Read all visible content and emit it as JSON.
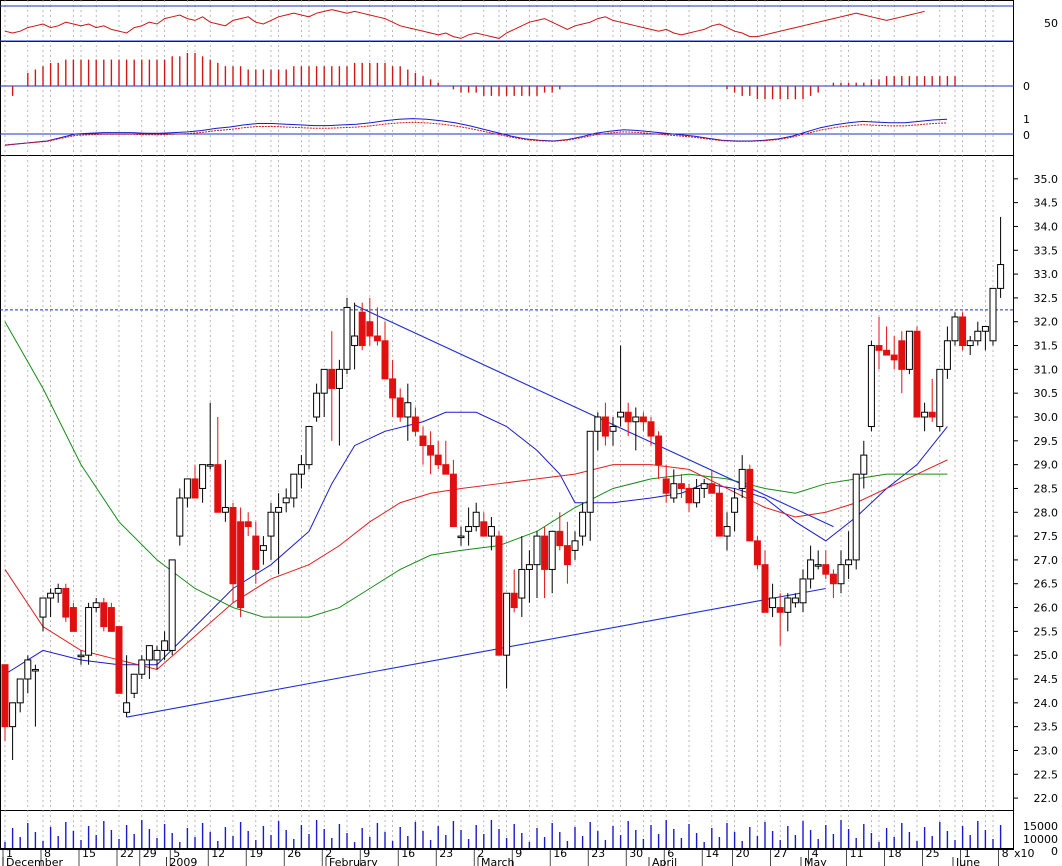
{
  "chart_data": {
    "type": "candlestick",
    "price_axis": {
      "min": 21.75,
      "max": 35.5,
      "ticks": [
        "22.0",
        "22.5",
        "23.0",
        "23.5",
        "24.0",
        "24.5",
        "25.0",
        "25.5",
        "26.0",
        "26.5",
        "27.0",
        "27.5",
        "28.0",
        "28.5",
        "29.0",
        "29.5",
        "30.0",
        "30.5",
        "31.0",
        "31.5",
        "32.0",
        "32.5",
        "33.0",
        "33.5",
        "34.0",
        "34.5",
        "35.0"
      ]
    },
    "x_axis": {
      "days": 131,
      "day_labels": [
        {
          "i": 0,
          "t": "1"
        },
        {
          "i": 5,
          "t": "8"
        },
        {
          "i": 10,
          "t": "15"
        },
        {
          "i": 15,
          "t": "22"
        },
        {
          "i": 18,
          "t": "29"
        },
        {
          "i": 22,
          "t": "5"
        },
        {
          "i": 27,
          "t": "12"
        },
        {
          "i": 32,
          "t": "19"
        },
        {
          "i": 37,
          "t": "26"
        },
        {
          "i": 42,
          "t": "2"
        },
        {
          "i": 47,
          "t": "9"
        },
        {
          "i": 52,
          "t": "16"
        },
        {
          "i": 57,
          "t": "23"
        },
        {
          "i": 62,
          "t": "2"
        },
        {
          "i": 67,
          "t": "9"
        },
        {
          "i": 72,
          "t": "16"
        },
        {
          "i": 77,
          "t": "23"
        },
        {
          "i": 82,
          "t": "30"
        },
        {
          "i": 87,
          "t": "6"
        },
        {
          "i": 92,
          "t": "14"
        },
        {
          "i": 96,
          "t": "20"
        },
        {
          "i": 101,
          "t": "27"
        },
        {
          "i": 106,
          "t": "4"
        },
        {
          "i": 111,
          "t": "11"
        },
        {
          "i": 116,
          "t": "18"
        },
        {
          "i": 121,
          "t": "25"
        },
        {
          "i": 126,
          "t": "1"
        },
        {
          "i": 131,
          "t": "8"
        }
      ],
      "month_labels": [
        {
          "i": 0,
          "t": "December"
        },
        {
          "i": 21.5,
          "t": "2009"
        },
        {
          "i": 42.5,
          "t": "February"
        },
        {
          "i": 62.5,
          "t": "March"
        },
        {
          "i": 85,
          "t": "April"
        },
        {
          "i": 105,
          "t": "May"
        },
        {
          "i": 125,
          "t": "June"
        }
      ]
    },
    "candles": [
      [
        24.8,
        24.8,
        23.2,
        23.5
      ],
      [
        23.5,
        23.8,
        22.8,
        24.0
      ],
      [
        24.0,
        24.5,
        23.8,
        24.5
      ],
      [
        24.5,
        25.0,
        24.2,
        24.9
      ],
      [
        24.7,
        24.8,
        23.5,
        24.7
      ],
      [
        25.8,
        26.2,
        25.5,
        26.2
      ],
      [
        26.2,
        26.4,
        25.8,
        26.3
      ],
      [
        26.3,
        26.5,
        26.1,
        26.4
      ],
      [
        26.4,
        26.5,
        25.7,
        25.8
      ],
      [
        26.0,
        26.1,
        25.5,
        25.5
      ],
      [
        25.0,
        25.1,
        24.8,
        25.0
      ],
      [
        25.0,
        26.1,
        24.8,
        26.0
      ],
      [
        26.0,
        26.2,
        25.9,
        26.1
      ],
      [
        26.1,
        26.2,
        25.5,
        25.6
      ],
      [
        26.0,
        26.1,
        25.5,
        25.5
      ],
      [
        25.6,
        25.6,
        24.5,
        24.2
      ],
      [
        23.8,
        25.0,
        23.7,
        24.0
      ],
      [
        24.2,
        24.3,
        24.1,
        24.6
      ],
      [
        24.6,
        25.0,
        24.5,
        24.9
      ],
      [
        24.9,
        25.2,
        24.5,
        25.2
      ],
      [
        24.9,
        25.2,
        24.7,
        25.1
      ],
      [
        25.1,
        25.5,
        24.9,
        25.3
      ],
      [
        25.1,
        27.0,
        25.0,
        27.0
      ],
      [
        27.5,
        28.5,
        27.3,
        28.3
      ],
      [
        28.3,
        28.7,
        28.1,
        28.7
      ],
      [
        28.7,
        29.0,
        28.3,
        28.3
      ],
      [
        28.5,
        29.0,
        28.2,
        29.0
      ],
      [
        29.0,
        30.3,
        28.9,
        29.0
      ],
      [
        29.0,
        30.0,
        28.2,
        28.0
      ],
      [
        28.0,
        29.1,
        27.8,
        28.1
      ],
      [
        28.1,
        28.2,
        26.1,
        26.5
      ],
      [
        27.8,
        28.1,
        25.8,
        26.0
      ],
      [
        27.8,
        28.0,
        27.5,
        27.7
      ],
      [
        27.5,
        27.8,
        26.5,
        26.8
      ],
      [
        27.2,
        27.5,
        26.9,
        27.3
      ],
      [
        27.5,
        28.2,
        27.0,
        28.0
      ],
      [
        28.0,
        28.4,
        26.7,
        28.1
      ],
      [
        28.2,
        28.5,
        28.0,
        28.3
      ],
      [
        28.3,
        28.8,
        28.1,
        28.8
      ],
      [
        28.8,
        29.2,
        28.5,
        29.0
      ],
      [
        29.0,
        29.8,
        28.9,
        29.8
      ],
      [
        30.0,
        30.7,
        29.9,
        30.5
      ],
      [
        30.5,
        31.0,
        30.0,
        31.0
      ],
      [
        31.0,
        31.8,
        29.5,
        30.6
      ],
      [
        30.6,
        31.2,
        29.4,
        31.0
      ],
      [
        31.0,
        32.5,
        30.9,
        32.3
      ],
      [
        31.5,
        32.4,
        31.0,
        31.7
      ],
      [
        32.2,
        32.4,
        31.4,
        31.5
      ],
      [
        32.0,
        32.5,
        31.5,
        31.7
      ],
      [
        31.7,
        32.3,
        31.5,
        31.6
      ],
      [
        31.6,
        32.0,
        30.8,
        30.8
      ],
      [
        30.8,
        31.2,
        30.0,
        30.4
      ],
      [
        30.4,
        30.6,
        29.9,
        30.0
      ],
      [
        30.0,
        30.7,
        29.5,
        30.3
      ],
      [
        30.0,
        30.2,
        29.6,
        29.7
      ],
      [
        29.6,
        29.8,
        29.0,
        29.4
      ],
      [
        29.4,
        29.7,
        28.8,
        29.2
      ],
      [
        29.2,
        29.5,
        28.9,
        29.0
      ],
      [
        29.0,
        29.5,
        28.8,
        28.8
      ],
      [
        28.8,
        29.1,
        27.8,
        27.7
      ],
      [
        27.5,
        27.7,
        27.3,
        27.5
      ],
      [
        27.6,
        28.1,
        27.3,
        27.7
      ],
      [
        27.7,
        28.2,
        27.6,
        28.0
      ],
      [
        27.8,
        28.0,
        27.6,
        27.5
      ],
      [
        27.5,
        27.9,
        27.2,
        27.7
      ],
      [
        27.5,
        27.6,
        26.0,
        25.0
      ],
      [
        25.0,
        26.2,
        24.3,
        26.3
      ],
      [
        26.3,
        26.8,
        25.9,
        26.0
      ],
      [
        26.2,
        27.5,
        25.8,
        26.8
      ],
      [
        26.8,
        27.2,
        26.1,
        26.9
      ],
      [
        26.9,
        27.6,
        26.2,
        27.5
      ],
      [
        27.5,
        27.7,
        26.2,
        26.8
      ],
      [
        26.8,
        27.5,
        26.3,
        27.6
      ],
      [
        27.6,
        28.0,
        27.2,
        27.3
      ],
      [
        27.3,
        27.8,
        26.5,
        26.9
      ],
      [
        27.2,
        27.6,
        27.0,
        27.4
      ],
      [
        27.5,
        28.2,
        27.3,
        28.0
      ],
      [
        28.0,
        29.7,
        27.4,
        29.7
      ],
      [
        29.7,
        30.1,
        29.3,
        30.0
      ],
      [
        30.0,
        30.3,
        29.4,
        29.6
      ],
      [
        29.7,
        30.0,
        29.4,
        29.8
      ],
      [
        30.0,
        31.5,
        29.8,
        30.1
      ],
      [
        30.1,
        30.3,
        29.6,
        29.9
      ],
      [
        29.9,
        30.2,
        29.3,
        30.0
      ],
      [
        30.0,
        30.1,
        29.7,
        29.9
      ],
      [
        29.9,
        30.0,
        29.4,
        29.6
      ],
      [
        29.6,
        29.7,
        28.7,
        29.0
      ],
      [
        28.7,
        29.0,
        28.2,
        28.4
      ],
      [
        28.3,
        28.9,
        28.2,
        28.6
      ],
      [
        28.6,
        28.8,
        28.3,
        28.5
      ],
      [
        28.5,
        28.6,
        28.0,
        28.2
      ],
      [
        28.2,
        28.7,
        28.1,
        28.5
      ],
      [
        28.5,
        28.7,
        28.3,
        28.6
      ],
      [
        28.6,
        28.9,
        28.4,
        28.4
      ],
      [
        28.4,
        28.6,
        27.6,
        27.5
      ],
      [
        27.5,
        28.0,
        27.2,
        27.7
      ],
      [
        28.0,
        28.5,
        27.6,
        28.3
      ],
      [
        28.5,
        29.2,
        28.3,
        28.9
      ],
      [
        28.9,
        29.0,
        27.8,
        27.4
      ],
      [
        27.4,
        27.5,
        26.8,
        26.9
      ],
      [
        26.9,
        27.2,
        26.1,
        25.9
      ],
      [
        26.0,
        26.5,
        25.8,
        26.2
      ],
      [
        26.0,
        26.3,
        25.2,
        25.9
      ],
      [
        25.9,
        26.3,
        25.5,
        26.2
      ],
      [
        26.1,
        26.3,
        26.0,
        26.2
      ],
      [
        26.1,
        26.8,
        25.9,
        26.6
      ],
      [
        26.6,
        27.3,
        26.4,
        27.0
      ],
      [
        26.9,
        27.2,
        26.8,
        26.9
      ],
      [
        26.9,
        27.2,
        26.6,
        26.7
      ],
      [
        26.7,
        26.8,
        26.2,
        26.5
      ],
      [
        26.5,
        27.2,
        26.3,
        26.9
      ],
      [
        26.9,
        27.6,
        26.6,
        27.0
      ],
      [
        27.0,
        28.8,
        26.8,
        28.8
      ],
      [
        28.8,
        29.5,
        28.5,
        29.2
      ],
      [
        29.8,
        31.6,
        29.7,
        31.5
      ],
      [
        31.5,
        32.1,
        31.0,
        31.4
      ],
      [
        31.4,
        31.9,
        31.3,
        31.3
      ],
      [
        31.3,
        31.7,
        31.0,
        31.2
      ],
      [
        31.6,
        31.8,
        30.5,
        31.0
      ],
      [
        31.0,
        31.8,
        30.9,
        31.8
      ],
      [
        31.8,
        31.9,
        30.0,
        30.0
      ],
      [
        30.0,
        30.3,
        29.7,
        30.1
      ],
      [
        30.1,
        30.8,
        29.9,
        30.0
      ],
      [
        29.8,
        31.0,
        29.7,
        31.0
      ],
      [
        31.0,
        31.9,
        30.8,
        31.6
      ]
    ],
    "candles_tail": [
      [
        31.6,
        32.2,
        31.5,
        32.1
      ],
      [
        32.1,
        32.2,
        31.4,
        31.5
      ],
      [
        31.5,
        31.7,
        31.3,
        31.6
      ],
      [
        31.6,
        32.0,
        31.5,
        31.8
      ],
      [
        31.8,
        31.9,
        31.4,
        31.9
      ],
      [
        31.6,
        32.0,
        31.5,
        32.7
      ],
      [
        32.7,
        34.2,
        32.5,
        33.2
      ]
    ],
    "trendlines": [
      {
        "color": "#1f2fd1",
        "from": [
          16,
          23.7
        ],
        "to": [
          108,
          26.4
        ]
      },
      {
        "color": "#1f2fd1",
        "from": [
          46,
          32.35
        ],
        "to": [
          109,
          27.7
        ]
      }
    ],
    "resistance_level": 32.25,
    "moving_averages": [
      {
        "color": "#1a1acf",
        "points": [
          [
            0,
            24.6
          ],
          [
            5,
            25.1
          ],
          [
            10,
            24.9
          ],
          [
            15,
            24.8
          ],
          [
            20,
            24.8
          ],
          [
            25,
            25.6
          ],
          [
            30,
            26.4
          ],
          [
            35,
            26.9
          ],
          [
            40,
            27.6
          ],
          [
            43,
            28.6
          ],
          [
            46,
            29.4
          ],
          [
            50,
            29.7
          ],
          [
            55,
            29.9
          ],
          [
            58,
            30.1
          ],
          [
            62,
            30.1
          ],
          [
            66,
            29.8
          ],
          [
            70,
            29.3
          ],
          [
            73,
            28.8
          ],
          [
            75,
            28.2
          ],
          [
            80,
            28.2
          ],
          [
            85,
            28.3
          ],
          [
            89,
            28.4
          ],
          [
            92,
            28.6
          ],
          [
            96,
            28.5
          ],
          [
            100,
            28.3
          ],
          [
            104,
            27.8
          ],
          [
            108,
            27.4
          ],
          [
            112,
            27.9
          ],
          [
            116,
            28.5
          ],
          [
            120,
            29.0
          ],
          [
            124,
            29.8
          ]
        ]
      },
      {
        "color": "#e02020",
        "points": [
          [
            0,
            26.8
          ],
          [
            5,
            25.6
          ],
          [
            10,
            25.1
          ],
          [
            15,
            24.9
          ],
          [
            20,
            24.7
          ],
          [
            25,
            25.4
          ],
          [
            30,
            26.1
          ],
          [
            35,
            26.6
          ],
          [
            40,
            26.9
          ],
          [
            44,
            27.3
          ],
          [
            48,
            27.8
          ],
          [
            52,
            28.2
          ],
          [
            56,
            28.4
          ],
          [
            60,
            28.5
          ],
          [
            65,
            28.6
          ],
          [
            70,
            28.7
          ],
          [
            75,
            28.8
          ],
          [
            80,
            29.0
          ],
          [
            85,
            29.0
          ],
          [
            90,
            28.9
          ],
          [
            95,
            28.5
          ],
          [
            100,
            28.1
          ],
          [
            104,
            27.9
          ],
          [
            108,
            28.0
          ],
          [
            112,
            28.2
          ],
          [
            116,
            28.5
          ],
          [
            120,
            28.8
          ],
          [
            124,
            29.1
          ]
        ]
      },
      {
        "color": "#1a8a1a",
        "points": [
          [
            0,
            32.0
          ],
          [
            5,
            30.6
          ],
          [
            10,
            29.0
          ],
          [
            15,
            27.8
          ],
          [
            20,
            27.0
          ],
          [
            25,
            26.4
          ],
          [
            30,
            26.0
          ],
          [
            34,
            25.8
          ],
          [
            40,
            25.8
          ],
          [
            44,
            26.0
          ],
          [
            48,
            26.4
          ],
          [
            52,
            26.8
          ],
          [
            56,
            27.1
          ],
          [
            60,
            27.2
          ],
          [
            65,
            27.3
          ],
          [
            70,
            27.6
          ],
          [
            75,
            28.1
          ],
          [
            80,
            28.5
          ],
          [
            85,
            28.7
          ],
          [
            90,
            28.8
          ],
          [
            95,
            28.7
          ],
          [
            100,
            28.5
          ],
          [
            104,
            28.4
          ],
          [
            108,
            28.6
          ],
          [
            112,
            28.7
          ],
          [
            116,
            28.8
          ],
          [
            120,
            28.8
          ],
          [
            124,
            28.8
          ]
        ]
      }
    ],
    "oscillator_top": {
      "ticks": [
        "50"
      ]
    },
    "histogram": {
      "ticks": [
        "0"
      ],
      "values": [
        0,
        -3,
        0,
        4,
        5,
        6,
        7,
        7,
        8,
        8,
        8,
        8,
        8,
        8,
        8,
        8,
        8,
        8,
        8,
        8,
        8,
        8,
        9,
        9,
        10,
        10,
        9,
        8,
        7,
        6,
        6,
        6,
        5,
        5,
        5,
        5,
        5,
        5,
        6,
        6,
        6,
        6,
        6,
        6,
        6,
        6,
        7,
        7,
        7,
        7,
        7,
        6,
        6,
        5,
        4,
        3,
        2,
        1,
        0,
        -1,
        -2,
        -2,
        -2,
        -3,
        -3,
        -3,
        -3,
        -3,
        -3,
        -3,
        -3,
        -2,
        -2,
        -1,
        0,
        0,
        0,
        0,
        0,
        0,
        0,
        0,
        0,
        0,
        0,
        0,
        0,
        0,
        0,
        0,
        0,
        0,
        0,
        0,
        0,
        -1,
        -2,
        -3,
        -3,
        -4,
        -4,
        -4,
        -4,
        -4,
        -4,
        -4,
        -3,
        -2,
        0,
        1,
        1,
        1,
        1,
        1,
        2,
        2,
        3,
        3,
        3,
        3,
        3,
        3,
        3,
        3,
        3,
        3
      ]
    },
    "macd": {
      "ticks": [
        "1",
        "0"
      ]
    },
    "volume": {
      "ticks": [
        "15000",
        "10000",
        "5000",
        "0"
      ],
      "unit": "x10"
    }
  }
}
